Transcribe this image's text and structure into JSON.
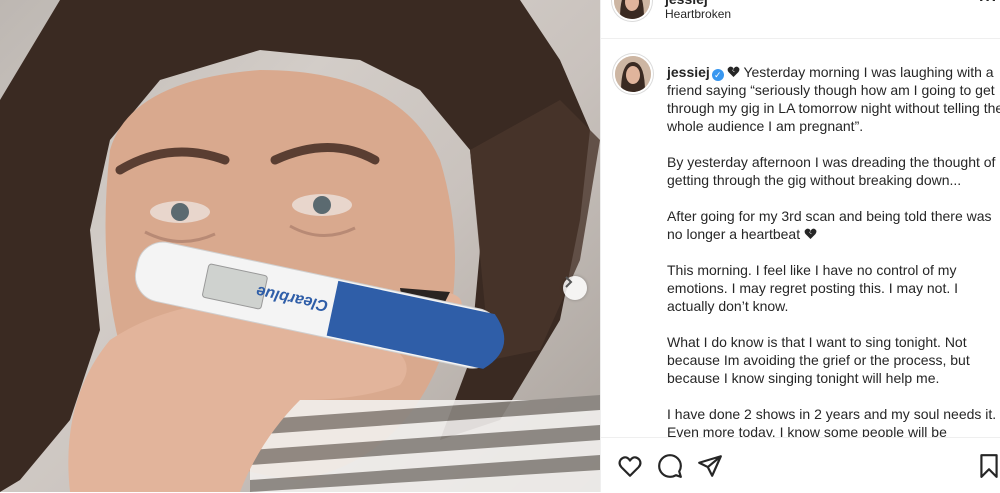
{
  "post": {
    "header": {
      "username": "jessiej",
      "subtitle": "Heartbroken",
      "more_label": "···"
    },
    "caption": {
      "username": "jessiej",
      "paragraphs": [
        "Yesterday morning I was laughing with a friend saying “seriously though how am I going to get through my gig in LA tomorrow night without telling the whole audience I am pregnant”.",
        "By yesterday afternoon I was dreading the thought of getting through the gig without breaking down...",
        "After going for my 3rd scan and being told there was no longer a heartbeat",
        "This morning. I feel like I have no control of my emotions. I may regret posting this. I may not. I actually don’t know.",
        "What I do know is that I want to sing tonight. Not because Im avoiding the grief or the process, but because I know singing tonight will help me.",
        "I have done 2 shows in 2 years and my soul needs it. Even more today. I know some people will be"
      ]
    },
    "photo": {
      "test_brand": "Clearblue"
    },
    "actions": [
      "heart-icon",
      "comment-icon",
      "share-icon",
      "bookmark-icon"
    ],
    "colors": {
      "verified": "#3897f0",
      "broken_heart": "#262626",
      "test_blue": "#2f5ea8"
    }
  }
}
